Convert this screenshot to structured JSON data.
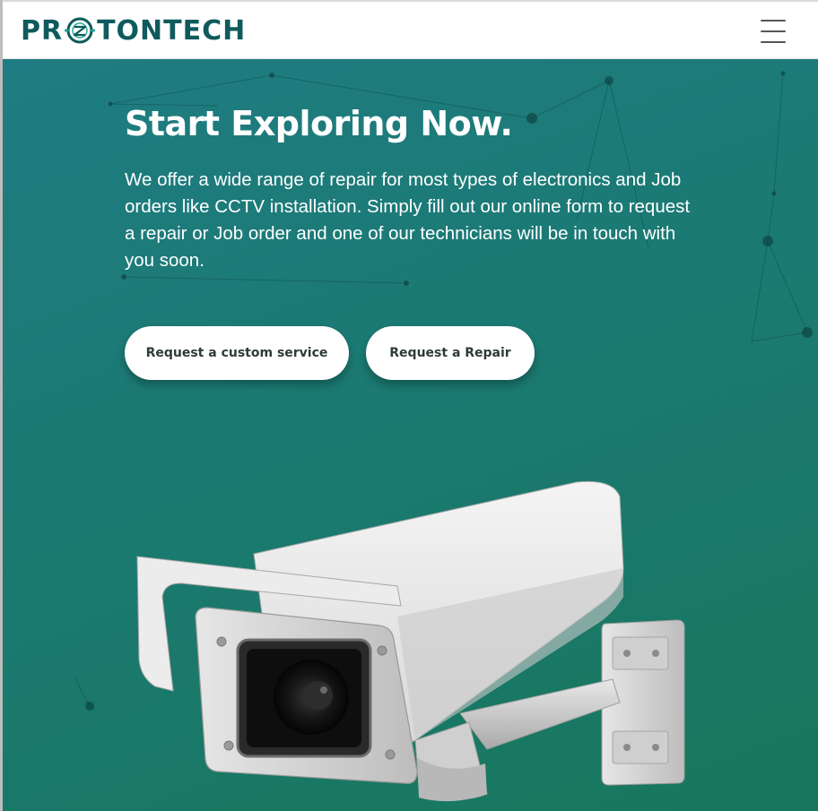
{
  "brand": {
    "name_part1": "PR",
    "name_part2": "TONTECH",
    "logo_icon": "circuit-o-icon",
    "color": "#0f5a5c"
  },
  "nav": {
    "menu_icon": "hamburger-menu-icon"
  },
  "hero": {
    "title": "Start Exploring Now.",
    "description": "We offer a wide range of repair for most types of electronics and Job orders like CCTV installation. Simply fill out our online form to request a repair or Job order and one of our technicians will be in touch with you soon.",
    "buttons": [
      {
        "label": "Request a custom service"
      },
      {
        "label": "Request a Repair"
      }
    ],
    "image": "cctv-camera-illustration",
    "gradient_start": "#1f7c82",
    "gradient_end": "#17775c"
  }
}
